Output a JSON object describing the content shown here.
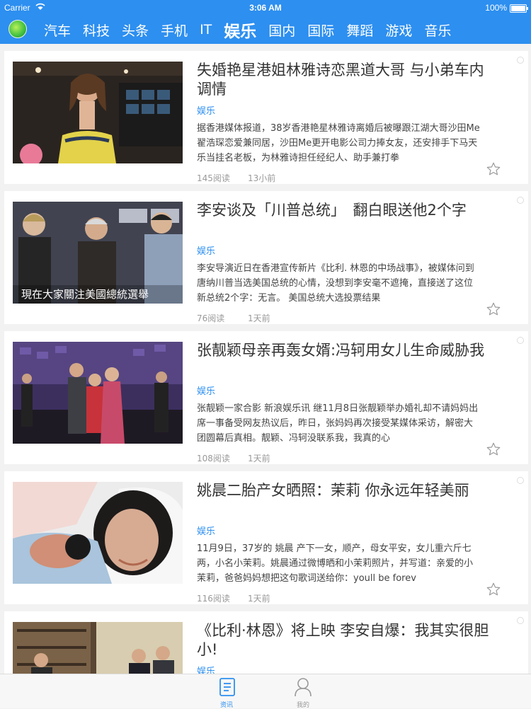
{
  "status_bar": {
    "carrier": "Carrier",
    "time": "3:06 AM",
    "battery": "100%"
  },
  "nav": {
    "tabs": [
      {
        "label": "汽车"
      },
      {
        "label": "科技"
      },
      {
        "label": "头条"
      },
      {
        "label": "手机"
      },
      {
        "label": "IT"
      },
      {
        "label": "娱乐",
        "active": true
      },
      {
        "label": "国内"
      },
      {
        "label": "国际"
      },
      {
        "label": "舞蹈"
      },
      {
        "label": "游戏"
      },
      {
        "label": "音乐"
      }
    ],
    "accent": "#2d8ff0"
  },
  "articles": [
    {
      "title": "失婚艳星港姐林雅诗恋黑道大哥 与小弟车内调情",
      "category": "娱乐",
      "summary": "据香港媒体报道，38岁香港艳星林雅诗离婚后被曝跟江湖大哥沙田Me翟浩琛恋爱兼同居，沙田Me更开电影公司力捧女友，还安排手下马天乐当挂名老板，为林雅诗担任经纪人、助手兼打拳",
      "reads": "145阅读",
      "time": "13小前"
    },
    {
      "title": "李安谈及「川普总统」　翻白眼送他2个字",
      "category": "娱乐",
      "summary": "李安导演近日在香港宣传新片《比利. 林恩的中场战事》，被媒体问到唐纳川普当选美国总统的心情，没想到李安毫不遮掩，直接送了这位新总统2个字：无言。 美国总统大选投票结果",
      "reads": "76阅读",
      "time": "1天前",
      "image_caption": "現在大家關注美國總統選舉"
    },
    {
      "title": "张靓颖母亲再轰女婿:冯轲用女儿生命威胁我",
      "category": "娱乐",
      "summary": "张靓颖一家合影 新浪娱乐讯 继11月8日张靓颖举办婚礼却不请妈妈出席一事备受网友热议后，昨日，张妈妈再次接受某媒体采访，解密大团圆幕后真相。靓颖、冯轲没联系我，我真的心",
      "reads": "108阅读",
      "time": "1天前"
    },
    {
      "title": "姚晨二胎产女晒照：茉莉 你永远年轻美丽",
      "category": "娱乐",
      "summary": "11月9日，37岁的 姚晨 产下一女，顺产，母女平安，女儿重六斤七两，小名小茉莉。姚晨通过微博晒和小茉莉照片，并写道：亲爱的小茉莉，爸爸妈妈想把这句歌词送给你：youll be forev",
      "reads": "116阅读",
      "time": "1天前"
    },
    {
      "title": "《比利·林恩》将上映 李安自爆：我其实很胆小!",
      "category": "娱乐",
      "summary": "",
      "reads": "",
      "time": ""
    }
  ],
  "bottom_tabs": [
    {
      "label": "资讯",
      "icon": "news-icon",
      "active": true
    },
    {
      "label": "我的",
      "icon": "user-icon",
      "active": false
    }
  ]
}
